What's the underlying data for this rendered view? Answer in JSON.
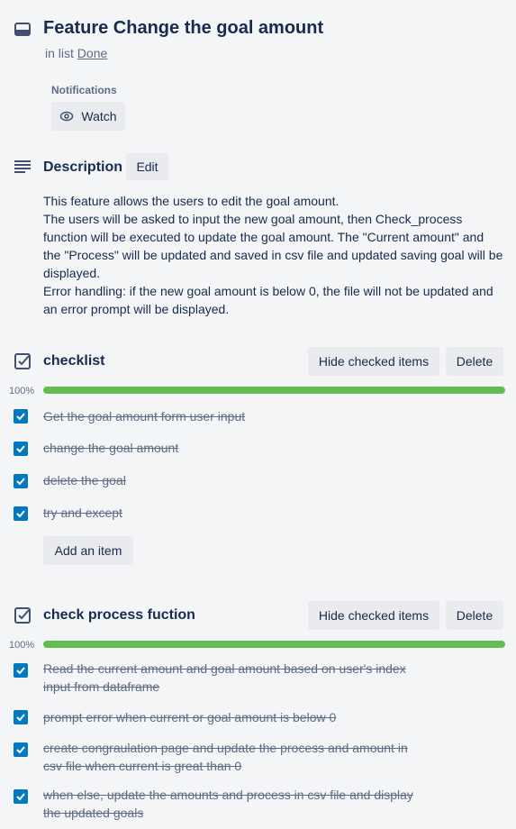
{
  "card": {
    "title": "Feature Change the goal amount",
    "in_list_prefix": "in list",
    "list_name": "Done"
  },
  "notifications": {
    "label": "Notifications",
    "watch_label": "Watch"
  },
  "description": {
    "heading": "Description",
    "edit_label": "Edit",
    "lines": [
      "This feature allows the users to edit the goal amount.",
      "The users will be asked to input the new goal amount, then Check_process function will be executed to update the goal amount. The \"Current amount\" and the \"Process\" will be updated and saved in csv file and updated saving goal will be displayed.",
      "Error handling: if the new goal amount is below 0, the file will not be updated and an error prompt will be displayed."
    ]
  },
  "checklists": [
    {
      "title": "checklist",
      "progress_text": "100%",
      "progress": 1.0,
      "hide_label": "Hide checked items",
      "delete_label": "Delete",
      "add_item_label": "Add an item",
      "items": [
        {
          "text": "Get the goal amount form user input",
          "checked": true
        },
        {
          "text": "change the goal amount",
          "checked": true
        },
        {
          "text": "delete the goal",
          "checked": true
        },
        {
          "text": "try and except",
          "checked": true
        }
      ]
    },
    {
      "title": "check process fuction",
      "progress_text": "100%",
      "progress": 1.0,
      "hide_label": "Hide checked items",
      "delete_label": "Delete",
      "items": [
        {
          "text": "Read the current amount and goal amount based on user's index input from dataframe",
          "checked": true
        },
        {
          "text": "prompt error when current or goal amount is below 0",
          "checked": true
        },
        {
          "text": "create congraulation page and update the process and amount in csv file when current is great than 0",
          "checked": true
        },
        {
          "text": "when else, update the amounts and process in csv file and display the updated goals",
          "checked": true
        }
      ]
    }
  ],
  "colors": {
    "accent": "#0079bf",
    "progress_complete": "#61bd4f",
    "button_bg": "#e9ebee",
    "text_primary": "#172b4d",
    "text_muted": "#5e6c84"
  },
  "icons": {
    "card": "card-icon",
    "watch": "eye-icon",
    "description": "description-lines-icon",
    "checklist": "checklist-icon",
    "checkbox": "checkmark-icon"
  }
}
